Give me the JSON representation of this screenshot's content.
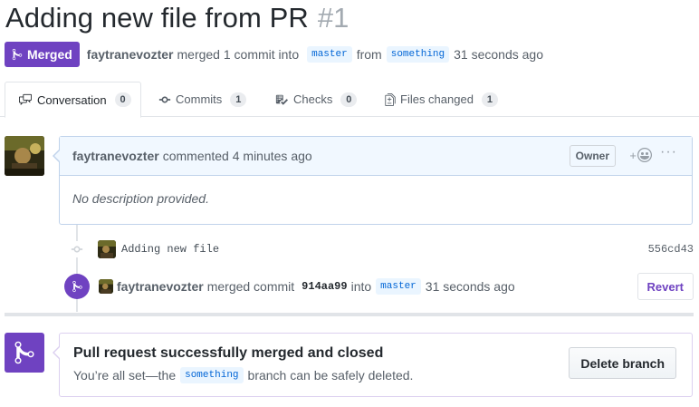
{
  "header": {
    "title": "Adding new file from PR",
    "number": "#1"
  },
  "meta": {
    "state": "Merged",
    "author": "faytranevozter",
    "action": "merged 1 commit into",
    "base_branch": "master",
    "from_word": "from",
    "head_branch": "something",
    "time": "31 seconds ago"
  },
  "tabs": [
    {
      "label": "Conversation",
      "count": "0"
    },
    {
      "label": "Commits",
      "count": "1"
    },
    {
      "label": "Checks",
      "count": "0"
    },
    {
      "label": "Files changed",
      "count": "1"
    }
  ],
  "comment": {
    "author": "faytranevozter",
    "action": "commented 4 minutes ago",
    "badge": "Owner",
    "body": "No description provided."
  },
  "commit": {
    "message": "Adding new file",
    "sha": "556cd43"
  },
  "merge_event": {
    "author": "faytranevozter",
    "action": "merged commit",
    "sha": "914aa99",
    "into_word": "into",
    "branch": "master",
    "time": "31 seconds ago",
    "revert_label": "Revert"
  },
  "merge_box": {
    "title": "Pull request successfully merged and closed",
    "desc_prefix": "You’re all set—the",
    "branch": "something",
    "desc_suffix": "branch can be safely deleted.",
    "delete_label": "Delete branch"
  },
  "colors": {
    "merged_purple": "#6f42c1",
    "link_blue": "#0366d6"
  },
  "icons": {
    "state": "git-merge-icon",
    "conversation": "comment-discussion-icon",
    "commits": "git-commit-icon",
    "checks": "checklist-icon",
    "files": "file-diff-icon",
    "reaction": "smiley-icon",
    "more": "kebab-horizontal-icon"
  }
}
